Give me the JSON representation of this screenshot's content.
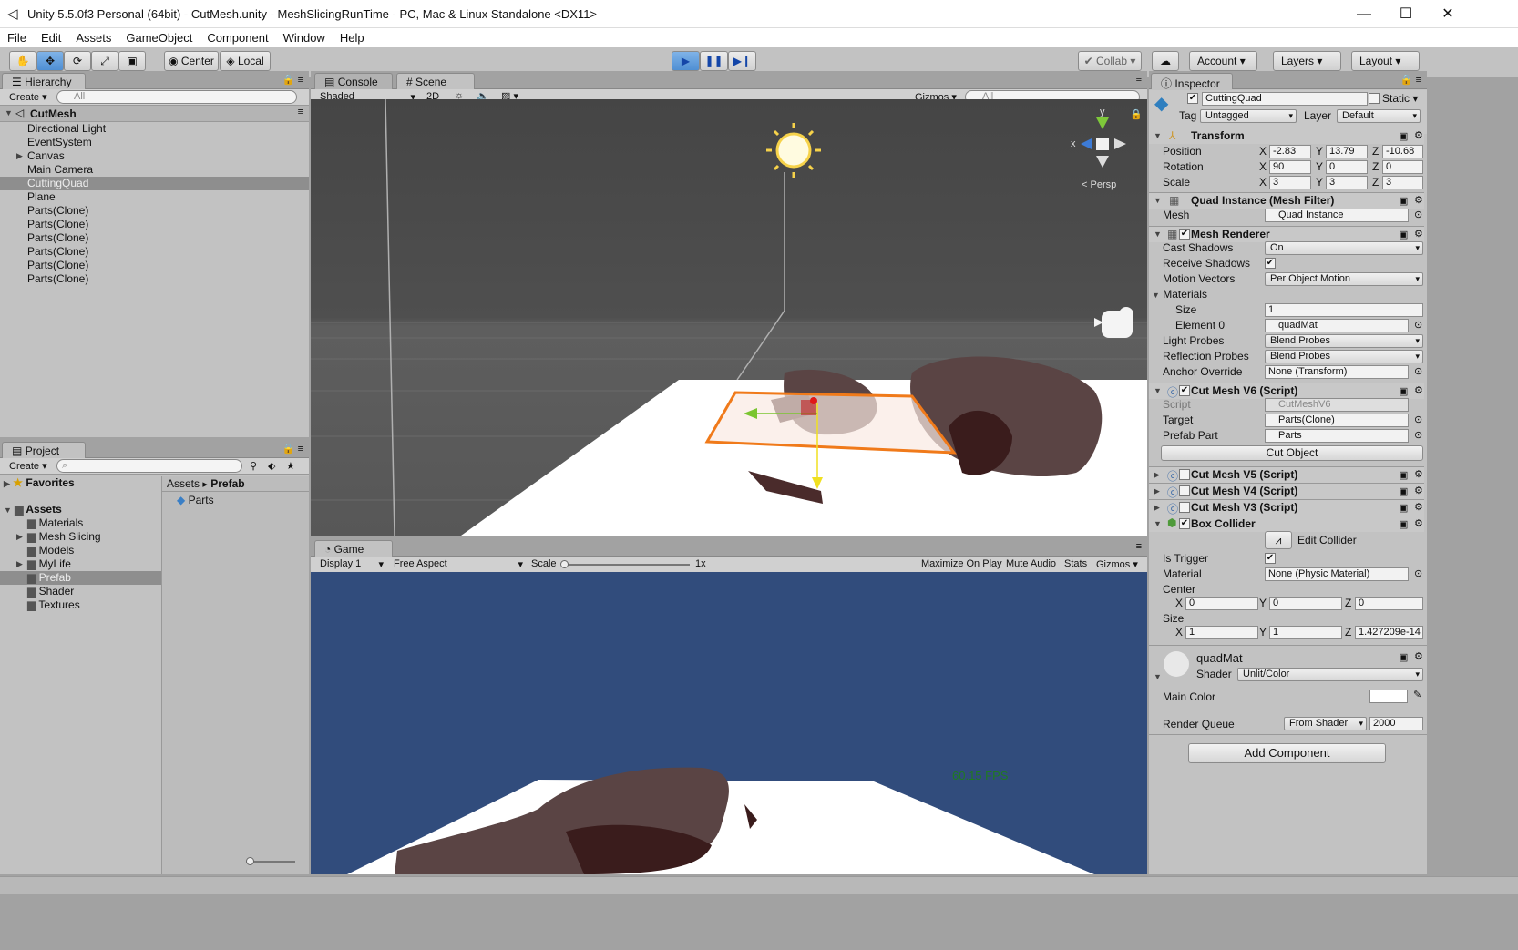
{
  "window": {
    "title": "Unity 5.5.0f3 Personal (64bit) - CutMesh.unity - MeshSlicingRunTime - PC, Mac & Linux Standalone <DX11>",
    "minimize": "—",
    "maximize": "☐",
    "close": "✕"
  },
  "menu": [
    "File",
    "Edit",
    "Assets",
    "GameObject",
    "Component",
    "Window",
    "Help"
  ],
  "toolbar": {
    "pivot": "Center",
    "space": "Local",
    "collab": "Collab",
    "account": "Account",
    "layers": "Layers",
    "layout": "Layout"
  },
  "hierarchy": {
    "tab": "Hierarchy",
    "create": "Create",
    "search_placeholder": "All",
    "scene": "CutMesh",
    "items": [
      "Directional Light",
      "EventSystem",
      "Canvas",
      "Main Camera",
      "CuttingQuad",
      "Plane",
      "Parts(Clone)",
      "Parts(Clone)",
      "Parts(Clone)",
      "Parts(Clone)",
      "Parts(Clone)",
      "Parts(Clone)"
    ],
    "selected_index": 4
  },
  "project": {
    "tab": "Project",
    "create": "Create",
    "favorites": "Favorites",
    "assets": "Assets",
    "folders": [
      "Materials",
      "Mesh Slicing",
      "Models",
      "MyLife",
      "Prefab",
      "Shader",
      "Textures"
    ],
    "selected_folder": 4,
    "breadcrumb_root": "Assets",
    "breadcrumb_leaf": "Prefab",
    "files": [
      "Parts"
    ]
  },
  "scene_view": {
    "tab_console": "Console",
    "tab_scene": "Scene",
    "shading": "Shaded",
    "mode_2d": "2D",
    "gizmos": "Gizmos",
    "search_placeholder": "All",
    "persp": "Persp",
    "axis_y": "y",
    "axis_x": "x"
  },
  "game_view": {
    "tab": "Game",
    "display": "Display 1",
    "aspect": "Free Aspect",
    "scale_label": "Scale",
    "scale_value": "1x",
    "maximize": "Maximize On Play",
    "mute": "Mute Audio",
    "stats": "Stats",
    "gizmos": "Gizmos",
    "fps": "60.15 FPS"
  },
  "inspector": {
    "tab": "Inspector",
    "object_name": "CuttingQuad",
    "static": "Static",
    "tag_label": "Tag",
    "tag": "Untagged",
    "layer_label": "Layer",
    "layer": "Default",
    "transform": {
      "title": "Transform",
      "rows": [
        {
          "label": "Position",
          "x": "-2.83",
          "y": "13.79",
          "z": "-10.68"
        },
        {
          "label": "Rotation",
          "x": "90",
          "y": "0",
          "z": "0"
        },
        {
          "label": "Scale",
          "x": "3",
          "y": "3",
          "z": "3"
        }
      ]
    },
    "mesh_filter": {
      "title": "Quad Instance (Mesh Filter)",
      "mesh_label": "Mesh",
      "mesh": "Quad Instance"
    },
    "mesh_renderer": {
      "title": "Mesh Renderer",
      "cast_shadows_label": "Cast Shadows",
      "cast_shadows": "On",
      "receive_shadows_label": "Receive Shadows",
      "motion_vectors_label": "Motion Vectors",
      "motion_vectors": "Per Object Motion",
      "materials_label": "Materials",
      "size_label": "Size",
      "size": "1",
      "element0_label": "Element 0",
      "element0": "quadMat",
      "light_probes_label": "Light Probes",
      "light_probes": "Blend Probes",
      "reflection_probes_label": "Reflection Probes",
      "reflection_probes": "Blend Probes",
      "anchor_override_label": "Anchor Override",
      "anchor_override": "None (Transform)"
    },
    "cutmesh_v6": {
      "title": "Cut Mesh V6 (Script)",
      "script_label": "Script",
      "script": "CutMeshV6",
      "target_label": "Target",
      "target": "Parts(Clone)",
      "prefab_label": "Prefab Part",
      "prefab": "Parts",
      "button": "Cut Object"
    },
    "cutmesh_v5": "Cut Mesh V5 (Script)",
    "cutmesh_v4": "Cut Mesh V4 (Script)",
    "cutmesh_v3": "Cut Mesh V3 (Script)",
    "box_collider": {
      "title": "Box Collider",
      "edit": "Edit Collider",
      "is_trigger_label": "Is Trigger",
      "material_label": "Material",
      "material": "None (Physic Material)",
      "center_label": "Center",
      "center": {
        "x": "0",
        "y": "0",
        "z": "0"
      },
      "size_label": "Size",
      "size": {
        "x": "1",
        "y": "1",
        "z": "1.427209e-14"
      }
    },
    "material": {
      "name": "quadMat",
      "shader_label": "Shader",
      "shader": "Unlit/Color",
      "main_color_label": "Main Color",
      "render_queue_label": "Render Queue",
      "render_queue_mode": "From Shader",
      "render_queue": "2000"
    },
    "add_component": "Add Component"
  },
  "axis_labels": {
    "x": "X",
    "y": "Y",
    "z": "Z"
  },
  "colors": {
    "scene_bg_top": "#464646",
    "game_sky": "#314c7c",
    "fps": "#1f7a22",
    "selection_orange": "#f07a1a"
  }
}
